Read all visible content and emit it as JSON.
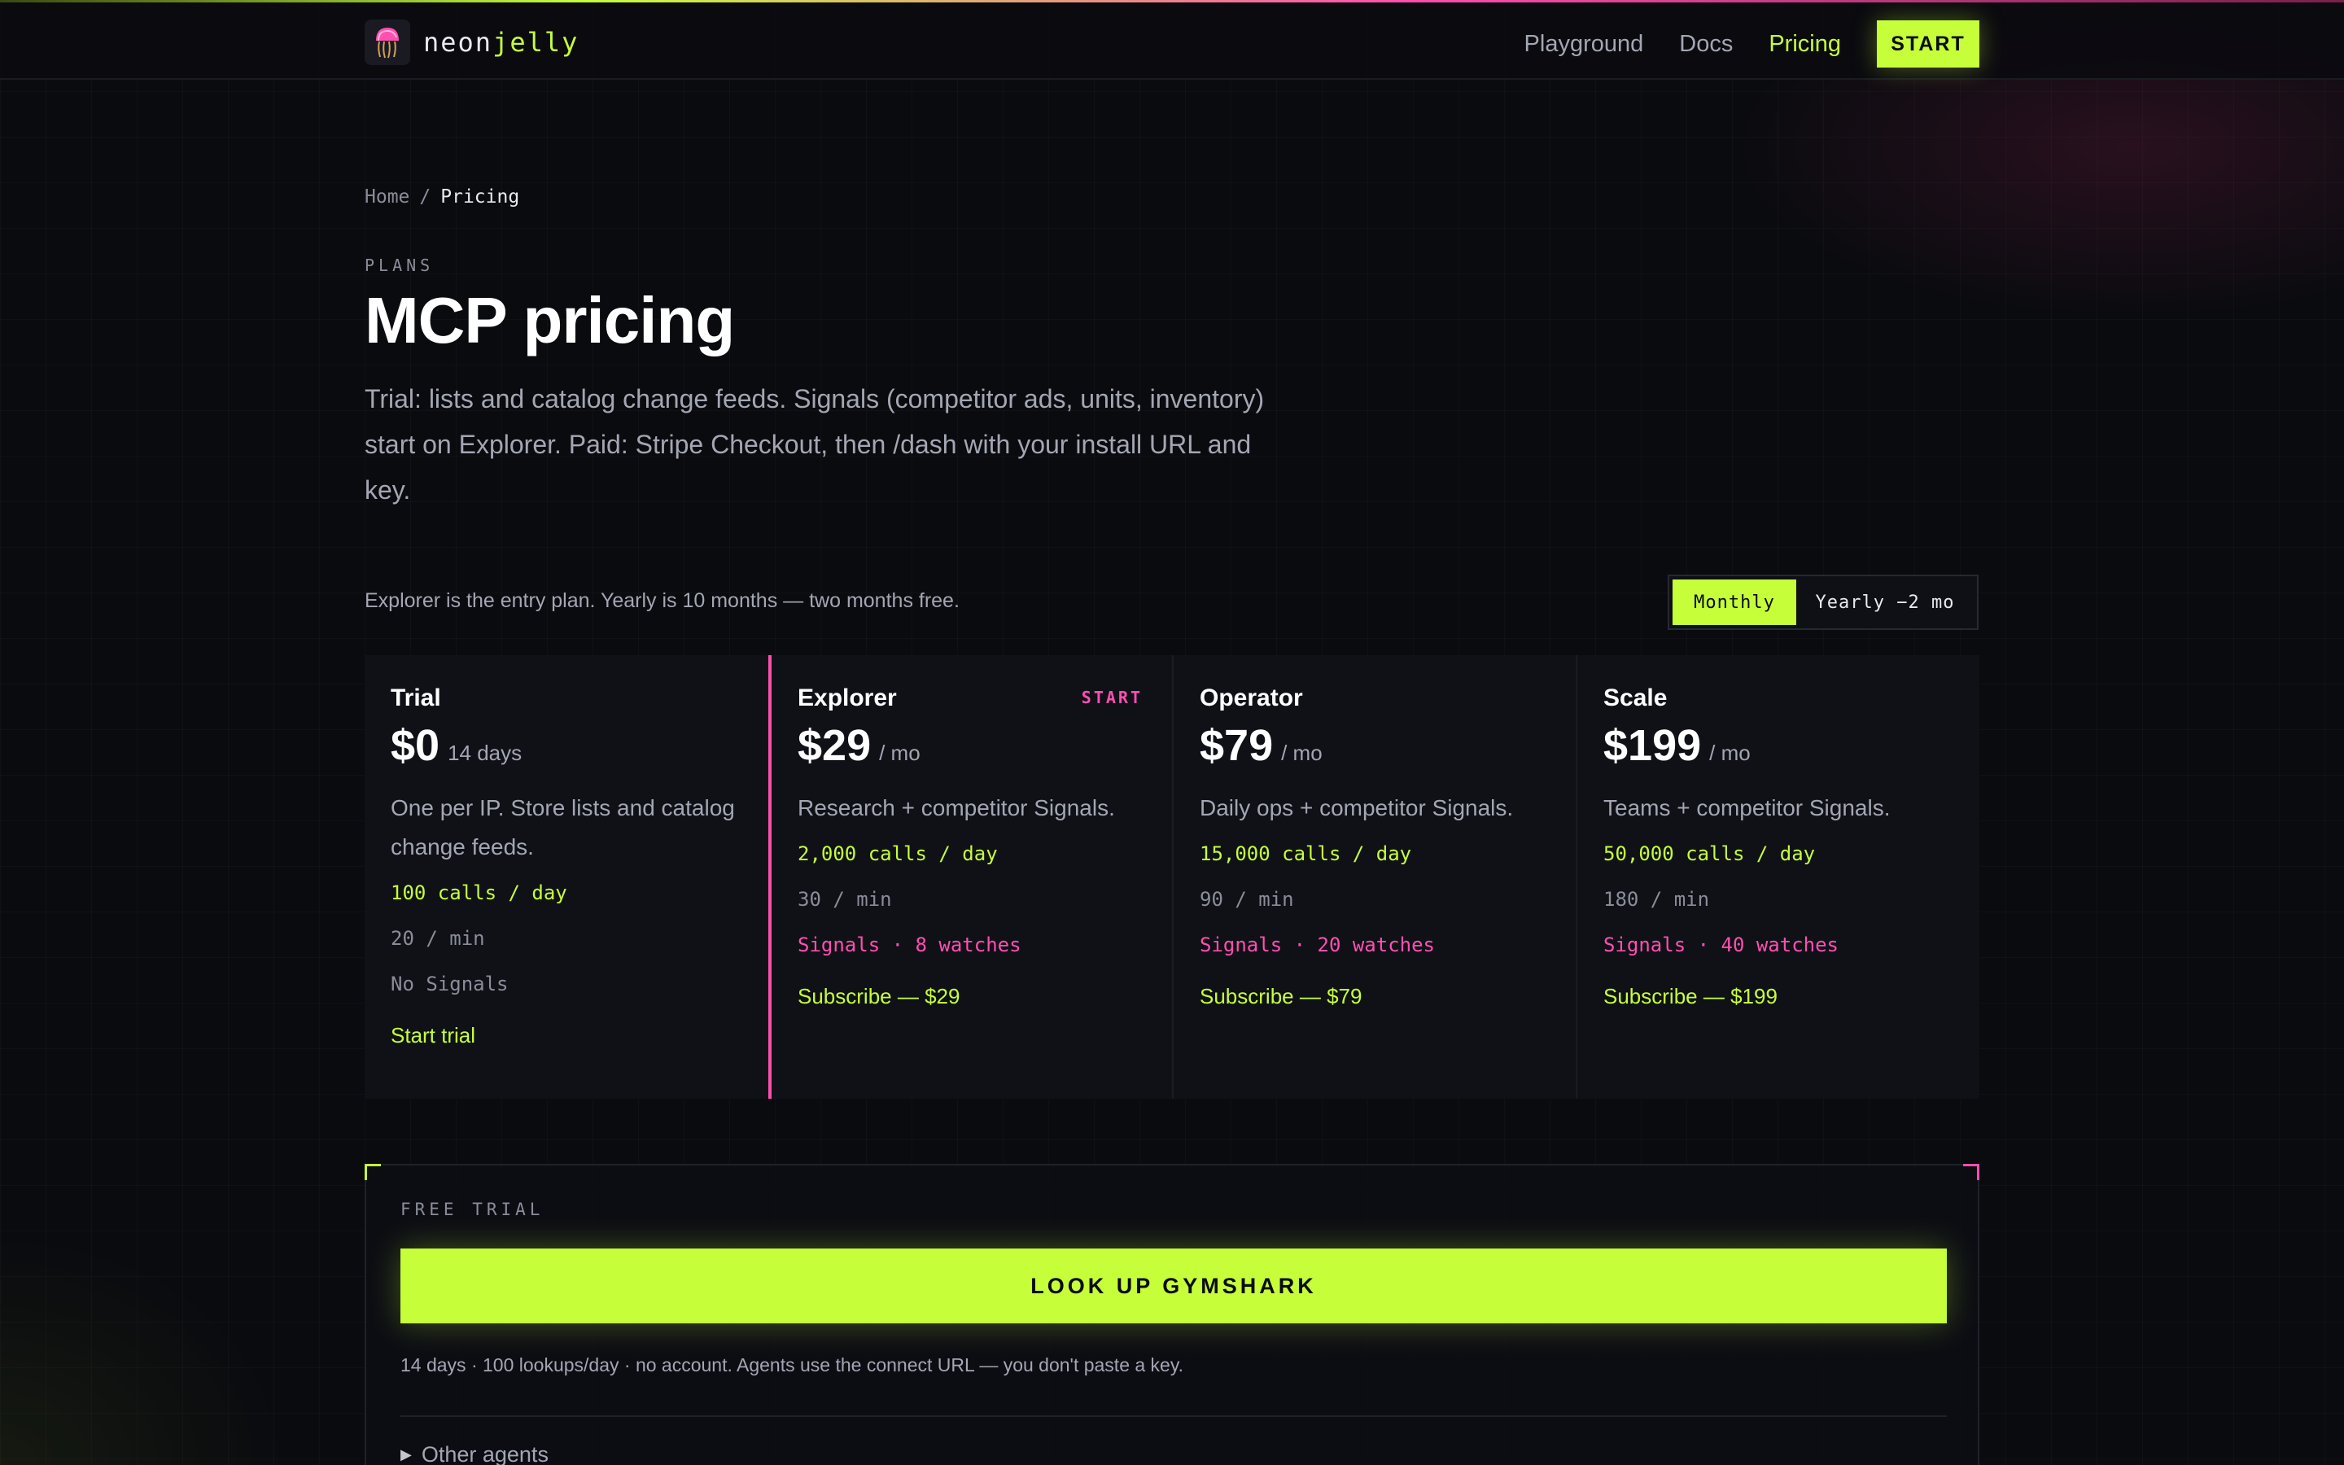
{
  "brand": {
    "name_a": "neon",
    "name_b": "jelly",
    "logo_icon": "jellyfish-icon"
  },
  "nav": {
    "links": [
      "Playground",
      "Docs",
      "Pricing"
    ],
    "active": "Pricing",
    "start_label": "START"
  },
  "breadcrumb": {
    "home": "Home",
    "separator": "/",
    "current": "Pricing"
  },
  "hero": {
    "eyebrow": "PLANS",
    "title": "MCP pricing",
    "lead": "Trial: lists and catalog change feeds. Signals (competitor ads, units, inventory) start on Explorer. Paid: Stripe Checkout, then /dash with your install URL and key."
  },
  "billing": {
    "note": "Explorer is the entry plan. Yearly is 10 months — two months free.",
    "monthly_label": "Monthly",
    "yearly_label": "Yearly −2 mo",
    "selected": "Monthly"
  },
  "plans": [
    {
      "name": "Trial",
      "tag": "",
      "price": "$0",
      "period": "14 days",
      "desc": "One per IP. Store lists and catalog change feeds.",
      "calls": "100 calls / day",
      "rate": "20 / min",
      "signals": "No Signals",
      "cta": "Start trial"
    },
    {
      "name": "Explorer",
      "tag": "START",
      "price": "$29",
      "period": "/ mo",
      "desc": "Research + competitor Signals.",
      "calls": "2,000 calls / day",
      "rate": "30 / min",
      "signals": "Signals · 8 watches",
      "cta": "Subscribe — $29"
    },
    {
      "name": "Operator",
      "tag": "",
      "price": "$79",
      "period": "/ mo",
      "desc": "Daily ops + competitor Signals.",
      "calls": "15,000 calls / day",
      "rate": "90 / min",
      "signals": "Signals · 20 watches",
      "cta": "Subscribe — $79"
    },
    {
      "name": "Scale",
      "tag": "",
      "price": "$199",
      "period": "/ mo",
      "desc": "Teams + competitor Signals.",
      "calls": "50,000 calls / day",
      "rate": "180 / min",
      "signals": "Signals · 40 watches",
      "cta": "Subscribe — $199"
    }
  ],
  "free_trial": {
    "eyebrow": "FREE TRIAL",
    "button_label": "LOOK UP GYMSHARK",
    "note": "14 days · 100 lookups/day · no account. Agents use the connect URL — you don't paste a key.",
    "details_label": "Other agents"
  },
  "colors": {
    "accent_lime": "#c6ff3a",
    "accent_pink": "#ff4fb0",
    "background": "#0a0b0f"
  }
}
